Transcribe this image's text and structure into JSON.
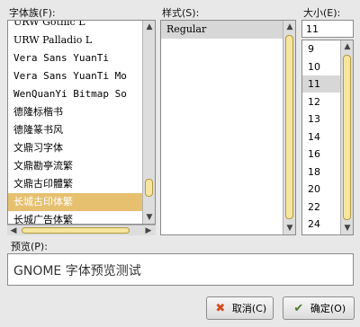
{
  "family": {
    "label": "字体族(F):",
    "items": [
      {
        "text": "URW Gothic L",
        "cls": "serif"
      },
      {
        "text": "URW Palladio L",
        "cls": "serif"
      },
      {
        "text": "Vera Sans YuanTi",
        "cls": "mono"
      },
      {
        "text": "Vera Sans YuanTi Mo",
        "cls": "mono"
      },
      {
        "text": "WenQuanYi Bitmap So",
        "cls": "mono"
      },
      {
        "text": "德隆标楷书",
        "cls": ""
      },
      {
        "text": "德隆篆书风",
        "cls": ""
      },
      {
        "text": "文鼎习字体",
        "cls": ""
      },
      {
        "text": "文鼎勘亭流繁",
        "cls": ""
      },
      {
        "text": "文鼎古印體繁",
        "cls": ""
      },
      {
        "text": "长城古印体繁",
        "cls": "sel"
      },
      {
        "text": "长城广告体繁",
        "cls": ""
      }
    ]
  },
  "style": {
    "label": "样式(S):",
    "items": [
      "Regular"
    ]
  },
  "size": {
    "label": "大小(E):",
    "value": "11",
    "items": [
      "9",
      "10",
      "11",
      "12",
      "13",
      "14",
      "16",
      "18",
      "20",
      "22",
      "24"
    ],
    "selected": "11"
  },
  "preview": {
    "label": "预览(P):",
    "text": "GNOME 字体预览测试"
  },
  "buttons": {
    "cancel": "取消(C)",
    "ok": "确定(O)"
  },
  "colors": {
    "selection": "#e6c06f",
    "cancel_icon": "#d24b1b",
    "ok_icon": "#4f7a2d"
  }
}
